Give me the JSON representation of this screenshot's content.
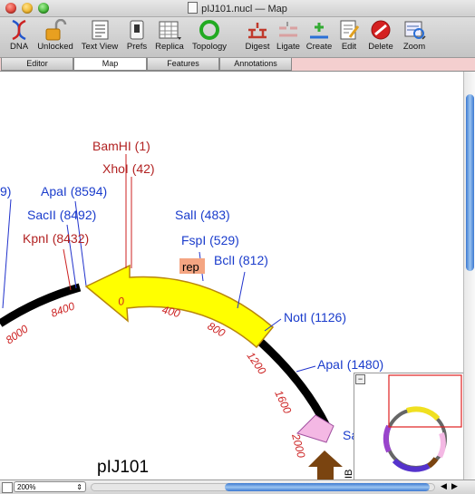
{
  "window": {
    "title": "pIJ101.nucl — Map"
  },
  "toolbar": {
    "buttons": [
      {
        "id": "dna",
        "label": "DNA"
      },
      {
        "id": "unlocked",
        "label": "Unlocked"
      },
      {
        "id": "textview",
        "label": "Text View"
      },
      {
        "id": "prefs",
        "label": "Prefs"
      },
      {
        "id": "replica",
        "label": "Replica"
      },
      {
        "id": "topology",
        "label": "Topology"
      },
      {
        "id": "digest",
        "label": "Digest"
      },
      {
        "id": "ligate",
        "label": "Ligate"
      },
      {
        "id": "create",
        "label": "Create"
      },
      {
        "id": "edit",
        "label": "Edit"
      },
      {
        "id": "delete",
        "label": "Delete"
      },
      {
        "id": "zoom",
        "label": "Zoom"
      }
    ]
  },
  "tabs": [
    "Editor",
    "Map",
    "Features",
    "Annotations"
  ],
  "active_tab": "Map",
  "map": {
    "plasmid_name": "pIJ101",
    "feature_label": "rep",
    "partial_side_label": "IB",
    "site_labels_red": [
      "BamHI (1)",
      "XhoI (42)",
      "KpnI (8432)"
    ],
    "site_labels_blue": [
      "9)",
      "ApaI (8594)",
      "SacII (8492)",
      "SalI (483)",
      "FspI (529)",
      "BclI (812)",
      "NotI (1126)",
      "ApaI (1480)",
      "Sa"
    ],
    "ticks": [
      "0",
      "400",
      "800",
      "1200",
      "1600",
      "2000",
      "8000",
      "8400"
    ]
  },
  "status": {
    "zoom": "200%"
  }
}
